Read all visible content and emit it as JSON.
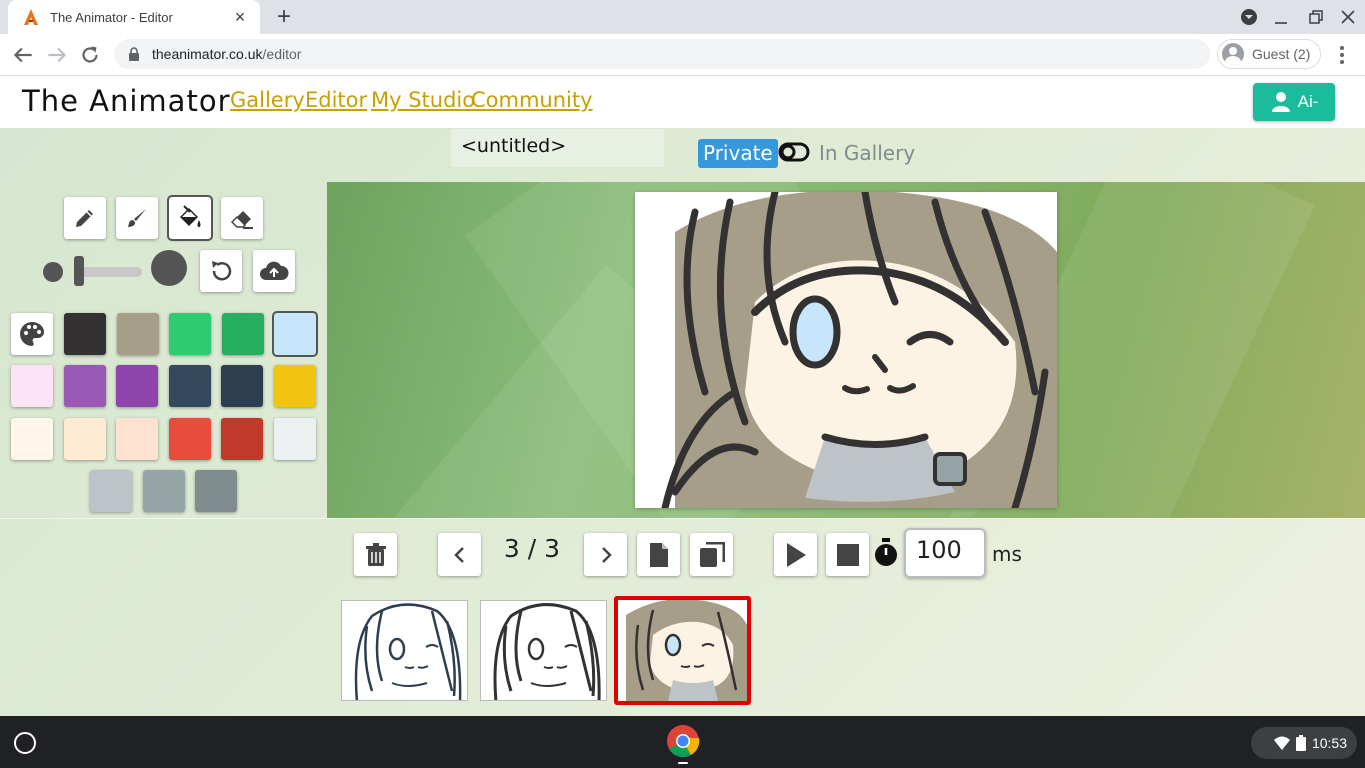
{
  "browser": {
    "tab_title": "The Animator - Editor",
    "tab_close": "×",
    "new_tab": "+",
    "url_domain": "theanimator.co.uk",
    "url_path": "/editor",
    "profile_label": "Guest (2)"
  },
  "site": {
    "logo": "The Animator",
    "nav": [
      "Gallery",
      "Editor",
      "My Studio",
      "Community"
    ],
    "user_button": "Ai-"
  },
  "editor": {
    "animation_title": "<untitled>",
    "visibility_private": "Private",
    "visibility_gallery": "In Gallery",
    "tools": [
      "pencil-tool",
      "brush-tool",
      "fill-tool",
      "eraser-tool"
    ],
    "active_tool": "fill-tool",
    "palette": {
      "row1": [
        "#333132",
        "#a79e8a",
        "#2ecc71",
        "#27ae60",
        "#c8e6fb"
      ],
      "row2": [
        "#fde3f5",
        "#9b59b6",
        "#8e44ad",
        "#34495e",
        "#2c3e50",
        "#f1c40f"
      ],
      "row3": [
        "#fef6e8",
        "#fdebd3",
        "#fde2d2",
        "#e74c3c",
        "#c0392b",
        "#ecf0f1"
      ],
      "row4": [
        "#bdc3c7",
        "#95a5a6",
        "#7f8c8d"
      ],
      "selected": "#c8e6fb"
    },
    "frame_counter": "3 / 3",
    "frame_delay": "100",
    "delay_unit": "ms",
    "frames_total": 3,
    "current_frame": 3
  },
  "taskbar": {
    "clock": "10:53"
  }
}
